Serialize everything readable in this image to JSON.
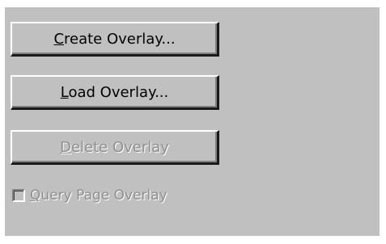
{
  "buttons": {
    "create": {
      "mnemonic": "C",
      "rest": "reate Overlay...",
      "enabled": true
    },
    "load": {
      "mnemonic": "L",
      "rest": "oad Overlay...",
      "enabled": true
    },
    "delete": {
      "mnemonic": "D",
      "rest": "elete Overlay",
      "enabled": false
    }
  },
  "query_checkbox": {
    "mnemonic": "Q",
    "rest": "uery Page Overlay",
    "checked": false,
    "enabled": false
  },
  "colors": {
    "face": "#c0c0c0",
    "disabled_text": "#8f8f8f",
    "highlight": "#ffffff",
    "shadow": "#808080"
  }
}
